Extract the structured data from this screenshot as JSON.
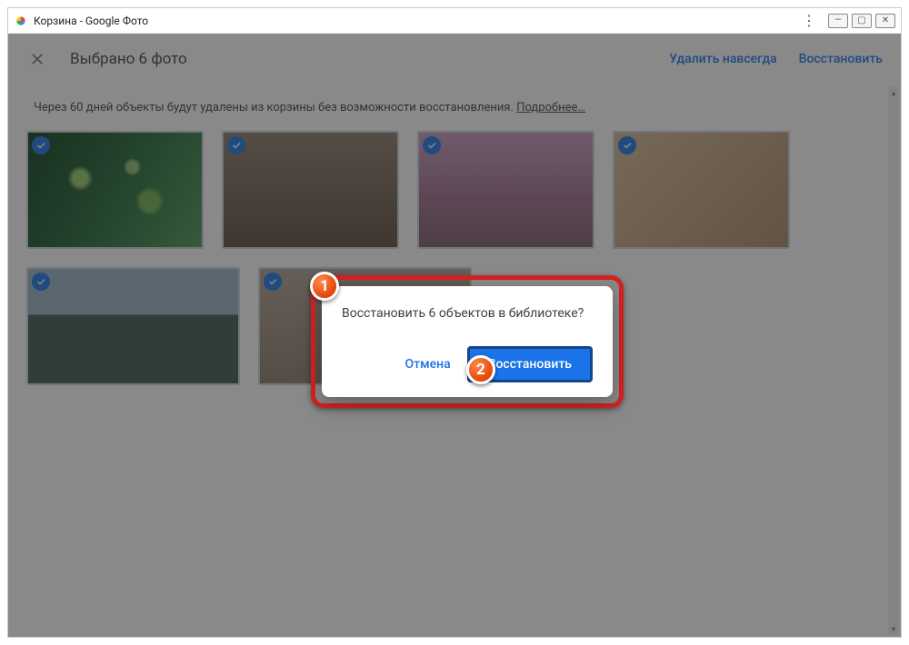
{
  "window": {
    "title": "Корзина - Google Фото"
  },
  "toolbar": {
    "selection": "Выбрано 6 фото",
    "delete_forever": "Удалить навсегда",
    "restore": "Восстановить"
  },
  "notice": {
    "text": "Через 60 дней объекты будут удалены из корзины без возможности восстановления.",
    "link": "Подробнее…"
  },
  "dialog": {
    "message": "Восстановить 6 объектов в библиотеке?",
    "cancel": "Отмена",
    "restore": "Восстановить"
  },
  "annotations": {
    "step1": "1",
    "step2": "2"
  }
}
